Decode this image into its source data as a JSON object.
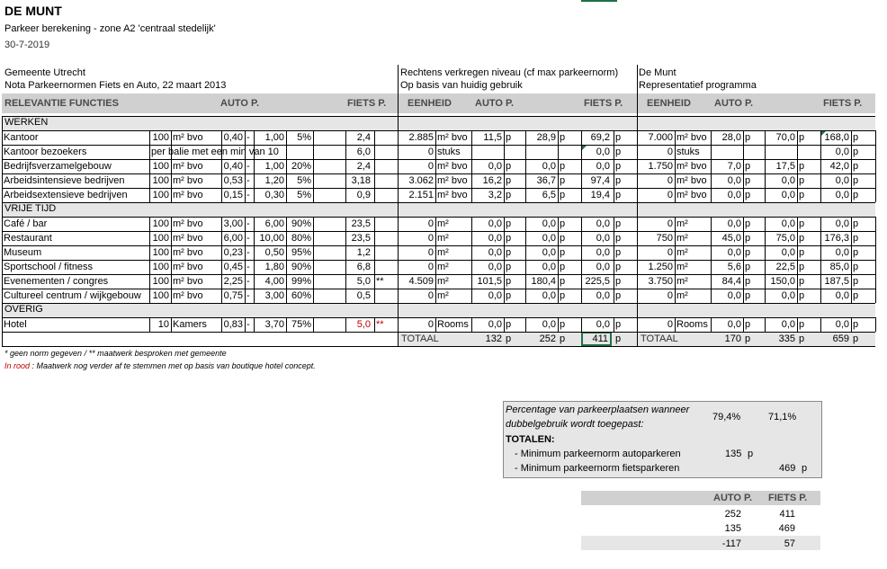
{
  "header": {
    "title": "DE MUNT",
    "subtitle": "Parkeer berekening - zone A2 'centraal stedelijk'",
    "date": "30-7-2019"
  },
  "blocks": {
    "left_1": "Gemeente Utrecht",
    "left_2": "Nota Parkeernormen Fiets en Auto, 22 maart 2013",
    "mid_1": "Rechtens verkregen niveau (cf max parkeernorm)",
    "mid_2": "Op basis van huidig gebruik",
    "right_1": "De Munt",
    "right_2": "Representatief programma"
  },
  "col_headers": {
    "relevantie": "RELEVANTIE FUNCTIES",
    "auto_p": "AUTO P.",
    "fiets_p": "FIETS P.",
    "eenheid": "EENHEID",
    "auto_p2": "AUTO P.",
    "fiets_p2": "FIETS P.",
    "eenheid2": "EENHEID",
    "auto_p3": "AUTO P.",
    "fiets_p3": "FIETS P."
  },
  "sections": {
    "werken": "WERKEN",
    "vrije_tijd": "VRIJE TIJD",
    "overig": "OVERIG"
  },
  "rows": [
    {
      "name": "Kantoor",
      "qty": "100",
      "unit": "m² bvo",
      "min": "0,40",
      "dash": "-",
      "max": "1,00",
      "pct": "5%",
      "fiets": "2,4",
      "star": "",
      "h_q": "2.885",
      "h_u": "m² bvo",
      "h_a": "11,5",
      "h_ap": "p",
      "h_b": "28,9",
      "h_bp": "p",
      "h_f": "69,2",
      "h_fp": "p",
      "r_q": "7.000",
      "r_u": "m² bvo",
      "r_a": "28,0",
      "r_ap": "p",
      "r_b": "70,0",
      "r_bp": "p",
      "r_f": "168,0",
      "r_fp": "p"
    },
    {
      "name": "Kantoor bezoekers",
      "qty": "",
      "unit": "per balie met een min van 10",
      "min": "",
      "dash": "",
      "max": "",
      "pct": "",
      "fiets": "6,0",
      "star": "",
      "h_q": "0",
      "h_u": "stuks",
      "h_a": "",
      "h_ap": "",
      "h_b": "",
      "h_bp": "",
      "h_f": "0,0",
      "h_fp": "p",
      "r_q": "0",
      "r_u": "stuks",
      "r_a": "",
      "r_ap": "",
      "r_b": "",
      "r_bp": "",
      "r_f": "0,0",
      "r_fp": "p"
    },
    {
      "name": "Bedrijfsverzamelgebouw",
      "qty": "100",
      "unit": "m² bvo",
      "min": "0,40",
      "dash": "-",
      "max": "1,00",
      "pct": "20%",
      "fiets": "2,4",
      "star": "",
      "h_q": "0",
      "h_u": "m² bvo",
      "h_a": "0,0",
      "h_ap": "p",
      "h_b": "0,0",
      "h_bp": "p",
      "h_f": "0,0",
      "h_fp": "p",
      "r_q": "1.750",
      "r_u": "m² bvo",
      "r_a": "7,0",
      "r_ap": "p",
      "r_b": "17,5",
      "r_bp": "p",
      "r_f": "42,0",
      "r_fp": "p"
    },
    {
      "name": "Arbeidsintensieve bedrijven",
      "qty": "100",
      "unit": "m² bvo",
      "min": "0,53",
      "dash": "-",
      "max": "1,20",
      "pct": "5%",
      "fiets": "3,18",
      "star": "",
      "h_q": "3.062",
      "h_u": "m² bvo",
      "h_a": "16,2",
      "h_ap": "p",
      "h_b": "36,7",
      "h_bp": "p",
      "h_f": "97,4",
      "h_fp": "p",
      "r_q": "0",
      "r_u": "m² bvo",
      "r_a": "0,0",
      "r_ap": "p",
      "r_b": "0,0",
      "r_bp": "p",
      "r_f": "0,0",
      "r_fp": "p"
    },
    {
      "name": "Arbeidsextensieve bedrijven",
      "qty": "100",
      "unit": "m² bvo",
      "min": "0,15",
      "dash": "-",
      "max": "0,30",
      "pct": "5%",
      "fiets": "0,9",
      "star": "",
      "h_q": "2.151",
      "h_u": "m² bvo",
      "h_a": "3,2",
      "h_ap": "p",
      "h_b": "6,5",
      "h_bp": "p",
      "h_f": "19,4",
      "h_fp": "p",
      "r_q": "0",
      "r_u": "m² bvo",
      "r_a": "0,0",
      "r_ap": "p",
      "r_b": "0,0",
      "r_bp": "p",
      "r_f": "0,0",
      "r_fp": "p"
    },
    {
      "name": "Café / bar",
      "qty": "100",
      "unit": "m² bvo",
      "min": "3,00",
      "dash": "-",
      "max": "6,00",
      "pct": "90%",
      "fiets": "23,5",
      "star": "",
      "h_q": "0",
      "h_u": "m²",
      "h_a": "0,0",
      "h_ap": "p",
      "h_b": "0,0",
      "h_bp": "p",
      "h_f": "0,0",
      "h_fp": "p",
      "r_q": "0",
      "r_u": "m²",
      "r_a": "0,0",
      "r_ap": "p",
      "r_b": "0,0",
      "r_bp": "p",
      "r_f": "0,0",
      "r_fp": "p"
    },
    {
      "name": "Restaurant",
      "qty": "100",
      "unit": "m² bvo",
      "min": "6,00",
      "dash": "-",
      "max": "10,00",
      "pct": "80%",
      "fiets": "23,5",
      "star": "",
      "h_q": "0",
      "h_u": "m²",
      "h_a": "0,0",
      "h_ap": "p",
      "h_b": "0,0",
      "h_bp": "p",
      "h_f": "0,0",
      "h_fp": "p",
      "r_q": "750",
      "r_u": "m²",
      "r_a": "45,0",
      "r_ap": "p",
      "r_b": "75,0",
      "r_bp": "p",
      "r_f": "176,3",
      "r_fp": "p"
    },
    {
      "name": "Museum",
      "qty": "100",
      "unit": "m² bvo",
      "min": "0,23",
      "dash": "-",
      "max": "0,50",
      "pct": "95%",
      "fiets": "1,2",
      "star": "",
      "h_q": "0",
      "h_u": "m²",
      "h_a": "0,0",
      "h_ap": "p",
      "h_b": "0,0",
      "h_bp": "p",
      "h_f": "0,0",
      "h_fp": "p",
      "r_q": "0",
      "r_u": "m²",
      "r_a": "0,0",
      "r_ap": "p",
      "r_b": "0,0",
      "r_bp": "p",
      "r_f": "0,0",
      "r_fp": "p"
    },
    {
      "name": "Sportschool / fitness",
      "qty": "100",
      "unit": "m² bvo",
      "min": "0,45",
      "dash": "-",
      "max": "1,80",
      "pct": "90%",
      "fiets": "6,8",
      "star": "",
      "h_q": "0",
      "h_u": "m²",
      "h_a": "0,0",
      "h_ap": "p",
      "h_b": "0,0",
      "h_bp": "p",
      "h_f": "0,0",
      "h_fp": "p",
      "r_q": "1.250",
      "r_u": "m²",
      "r_a": "5,6",
      "r_ap": "p",
      "r_b": "22,5",
      "r_bp": "p",
      "r_f": "85,0",
      "r_fp": "p"
    },
    {
      "name": "Evenementen / congres",
      "qty": "100",
      "unit": "m² bvo",
      "min": "2,25",
      "dash": "-",
      "max": "4,00",
      "pct": "99%",
      "fiets": "5,0",
      "star": "**",
      "h_q": "4.509",
      "h_u": "m²",
      "h_a": "101,5",
      "h_ap": "p",
      "h_b": "180,4",
      "h_bp": "p",
      "h_f": "225,5",
      "h_fp": "p",
      "r_q": "3.750",
      "r_u": "m²",
      "r_a": "84,4",
      "r_ap": "p",
      "r_b": "150,0",
      "r_bp": "p",
      "r_f": "187,5",
      "r_fp": "p"
    },
    {
      "name": "Cultureel centrum / wijkgebouw",
      "qty": "100",
      "unit": "m² bvo",
      "min": "0,75",
      "dash": "-",
      "max": "3,00",
      "pct": "60%",
      "fiets": "0,5",
      "star": "",
      "h_q": "0",
      "h_u": "m²",
      "h_a": "0,0",
      "h_ap": "p",
      "h_b": "0,0",
      "h_bp": "p",
      "h_f": "0,0",
      "h_fp": "p",
      "r_q": "0",
      "r_u": "m²",
      "r_a": "0,0",
      "r_ap": "p",
      "r_b": "0,0",
      "r_bp": "p",
      "r_f": "0,0",
      "r_fp": "p"
    },
    {
      "name": "Hotel",
      "qty": "10",
      "unit": "Kamers",
      "min": "0,83",
      "dash": "-",
      "max": "3,70",
      "pct": "75%",
      "fiets": "5,0",
      "star": "**",
      "h_q": "0",
      "h_u": "Rooms",
      "h_a": "0,0",
      "h_ap": "p",
      "h_b": "0,0",
      "h_bp": "p",
      "h_f": "0,0",
      "h_fp": "p",
      "r_q": "0",
      "r_u": "Rooms",
      "r_a": "0,0",
      "r_ap": "p",
      "r_b": "0,0",
      "r_bp": "p",
      "r_f": "0,0",
      "r_fp": "p"
    }
  ],
  "totals": {
    "label": "TOTAAL",
    "h_a": "132",
    "h_b": "252",
    "h_f": "411",
    "p": "p",
    "r_a": "170",
    "r_b": "335",
    "r_f": "659"
  },
  "notes": {
    "note1": "* geen norm gegeven / ** maatwerk besproken met gemeente",
    "note2_red": "In rood",
    "note2_rest": ": Maatwerk nog verder af te stemmen met op basis van boutique hotel concept."
  },
  "summary": {
    "pct_label_1": "Percentage van parkeerplaatsen wanneer",
    "pct_label_2": "dubbelgebruik wordt toegepast:",
    "pct_auto": "79,4%",
    "pct_fiets": "71,1%",
    "totalen": "TOTALEN:",
    "min_auto_label": "  -  Minimum parkeernorm autoparkeren",
    "min_auto_val": "135",
    "min_auto_p": "p",
    "min_fiets_label": "  -  Minimum parkeernorm fietsparkeren",
    "min_fiets_val": "469",
    "min_fiets_p": "p"
  },
  "compare": {
    "auto_hdr": "AUTO P.",
    "fiets_hdr": "FIETS P.",
    "rows": [
      [
        "252",
        "411"
      ],
      [
        "135",
        "469"
      ],
      [
        "-117",
        "57"
      ]
    ]
  }
}
